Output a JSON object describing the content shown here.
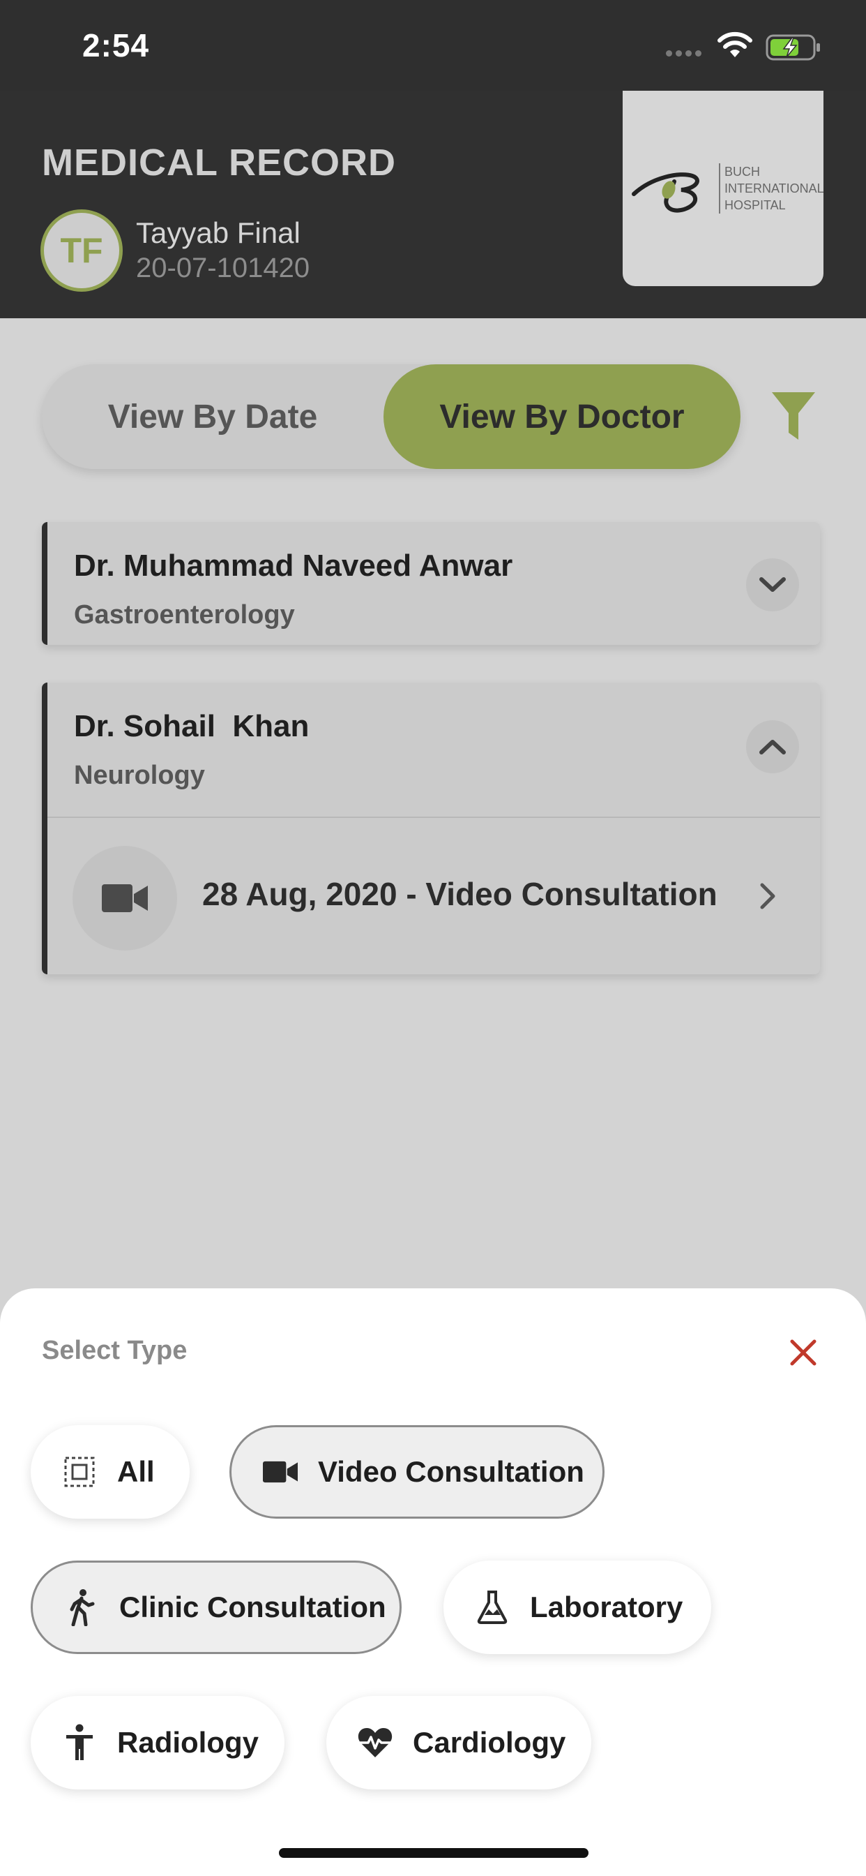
{
  "status_bar": {
    "time": "2:54"
  },
  "header": {
    "title": "MEDICAL RECORD",
    "avatar_initials": "TF",
    "patient_name": "Tayyab Final",
    "patient_id": "20-07-101420",
    "logo_lines": [
      "BUCH",
      "INTERNATIONAL",
      "HOSPITAL"
    ]
  },
  "view_toggle": {
    "options": [
      "View By Date",
      "View By Doctor"
    ],
    "selected": "View By Doctor"
  },
  "doctors": [
    {
      "name": "Dr. Muhammad Naveed Anwar",
      "specialty": "Gastroenterology",
      "expanded": false
    },
    {
      "name": "Dr. Sohail  Khan",
      "specialty": "Neurology",
      "expanded": true,
      "visits": [
        {
          "label": "28 Aug, 2020 - Video Consultation",
          "icon": "video-camera-icon"
        }
      ]
    }
  ],
  "type_sheet": {
    "title": "Select Type",
    "chips": [
      {
        "label": "All",
        "icon": "select-all-icon",
        "selected": false
      },
      {
        "label": "Video Consultation",
        "icon": "video-camera-icon",
        "selected": true
      },
      {
        "label": "Clinic Consultation",
        "icon": "walking-person-icon",
        "selected": true
      },
      {
        "label": "Laboratory",
        "icon": "flask-icon",
        "selected": false
      },
      {
        "label": "Radiology",
        "icon": "person-standing-icon",
        "selected": false
      },
      {
        "label": "Cardiology",
        "icon": "heart-pulse-icon",
        "selected": false
      }
    ]
  },
  "colors": {
    "accent": "#8fa050",
    "header_bg": "#303030",
    "close": "#c0392b"
  }
}
